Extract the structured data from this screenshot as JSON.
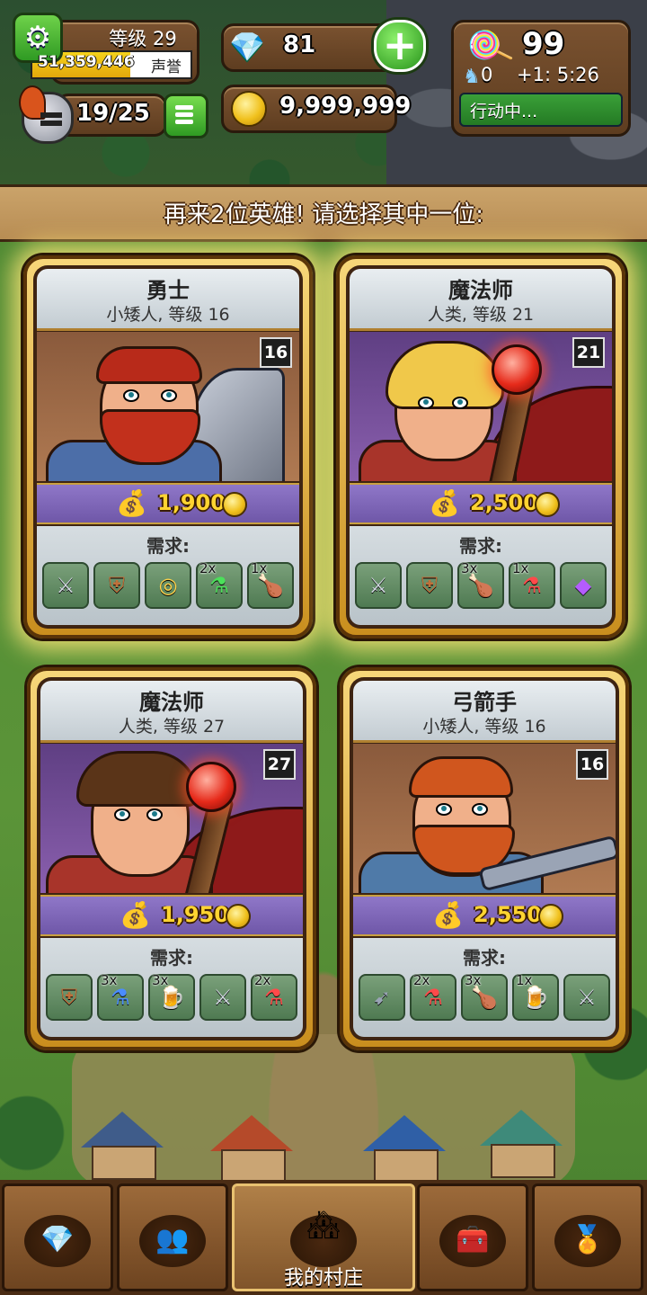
{
  "hud": {
    "level_text": "等级 29",
    "reputation_value": "51,359,446",
    "reputation_label": "声誉",
    "reputation_fill": 0.62,
    "hero_count": "19/25",
    "gems": "81",
    "gold": "9,999,999",
    "candy": "99",
    "unicorn_count": "0",
    "timer": "+1: 5:26",
    "status": "行动中..."
  },
  "banner": {
    "text": "再来2位英雄! 请选择其中一位:"
  },
  "requirements_label": "需求:",
  "heroes": [
    {
      "name": "勇士",
      "sub": "小矮人, 等级 16",
      "level": "16",
      "cost": "1,900",
      "items": [
        {
          "icon": "sword-icon",
          "glyph": "⚔",
          "mult": ""
        },
        {
          "icon": "armor-icon",
          "glyph": "⛨",
          "mult": ""
        },
        {
          "icon": "ring-icon",
          "glyph": "◎",
          "mult": ""
        },
        {
          "icon": "green-potion-icon",
          "glyph": "⚗",
          "mult": "2x"
        },
        {
          "icon": "meat-icon",
          "glyph": "🍗",
          "mult": "1x"
        }
      ]
    },
    {
      "name": "魔法师",
      "sub": "人类, 等级 21",
      "level": "21",
      "cost": "2,500",
      "items": [
        {
          "icon": "sword-icon",
          "glyph": "⚔",
          "mult": ""
        },
        {
          "icon": "armor-icon",
          "glyph": "⛨",
          "mult": ""
        },
        {
          "icon": "meat-icon",
          "glyph": "🍗",
          "mult": "3x"
        },
        {
          "icon": "red-potion-icon",
          "glyph": "⚗",
          "mult": "1x"
        },
        {
          "icon": "amulet-icon",
          "glyph": "◆",
          "mult": ""
        }
      ]
    },
    {
      "name": "魔法师",
      "sub": "人类, 等级 27",
      "level": "27",
      "cost": "1,950",
      "items": [
        {
          "icon": "armor-icon",
          "glyph": "⛨",
          "mult": ""
        },
        {
          "icon": "blue-potion-icon",
          "glyph": "⚗",
          "mult": "3x"
        },
        {
          "icon": "ale-icon",
          "glyph": "🍺",
          "mult": "3x"
        },
        {
          "icon": "sword-icon",
          "glyph": "⚔",
          "mult": ""
        },
        {
          "icon": "red-potion-icon",
          "glyph": "⚗",
          "mult": "2x"
        }
      ]
    },
    {
      "name": "弓箭手",
      "sub": "小矮人, 等级 16",
      "level": "16",
      "cost": "2,550",
      "items": [
        {
          "icon": "crossbow-icon",
          "glyph": "➹",
          "mult": ""
        },
        {
          "icon": "red-potion-icon",
          "glyph": "⚗",
          "mult": "2x"
        },
        {
          "icon": "meat-icon",
          "glyph": "🍗",
          "mult": "3x"
        },
        {
          "icon": "ale-icon",
          "glyph": "🍺",
          "mult": "1x"
        },
        {
          "icon": "sword-icon",
          "glyph": "⚔",
          "mult": ""
        }
      ]
    }
  ],
  "nav": {
    "items": [
      {
        "icon": "gems-icon",
        "glyph": "💎",
        "label": ""
      },
      {
        "icon": "heroes-icon",
        "glyph": "👥",
        "label": ""
      },
      {
        "icon": "village-icon",
        "glyph": "🏘",
        "label": "我的村庄"
      },
      {
        "icon": "chest-icon",
        "glyph": "🧰",
        "label": ""
      },
      {
        "icon": "medal-icon",
        "glyph": "🏅",
        "label": ""
      }
    ]
  },
  "colors": {
    "wood": "#6e4824",
    "gold": "#f0c01c",
    "cost_bar": "#7a62b4",
    "status_green": "#2f8f2e"
  }
}
